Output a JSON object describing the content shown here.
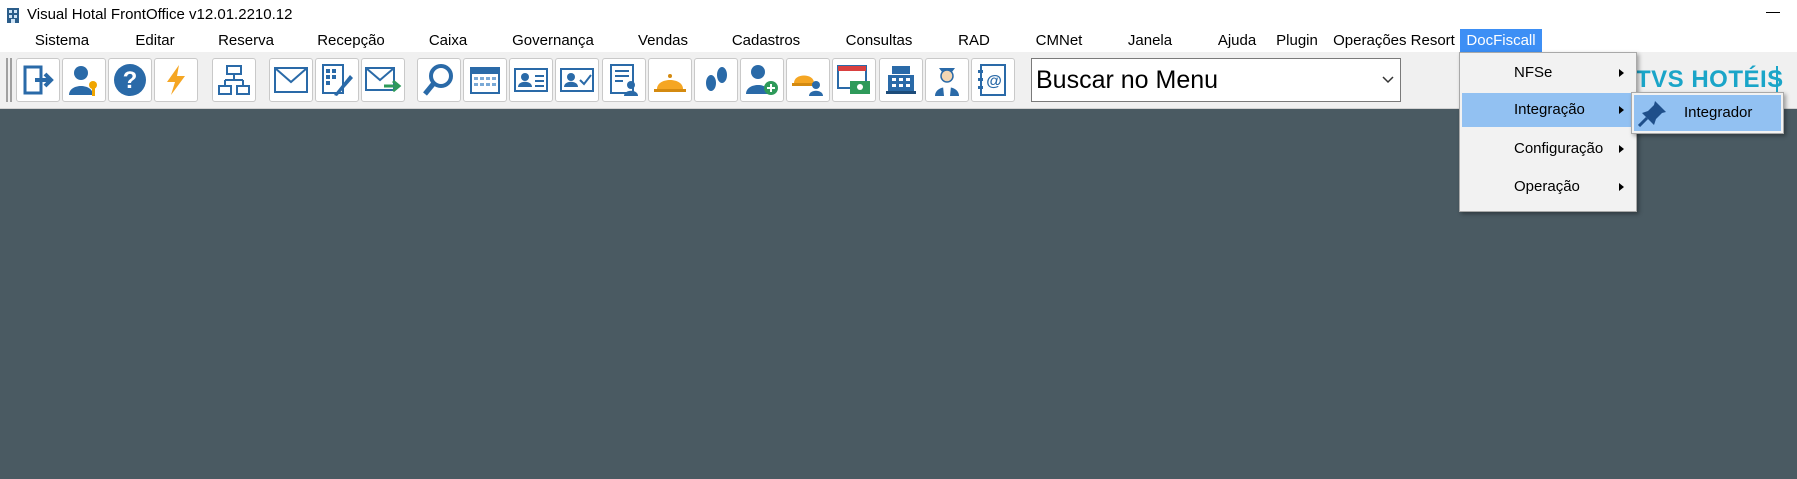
{
  "window": {
    "title": "Visual Hotal FrontOffice v12.01.2210.12"
  },
  "menu": [
    {
      "label": "Sistema"
    },
    {
      "label": "Editar"
    },
    {
      "label": "Reserva"
    },
    {
      "label": "Recepção"
    },
    {
      "label": "Caixa"
    },
    {
      "label": "Governança"
    },
    {
      "label": "Vendas"
    },
    {
      "label": "Cadastros"
    },
    {
      "label": "Consultas"
    },
    {
      "label": "RAD"
    },
    {
      "label": "CMNet"
    },
    {
      "label": "Janela"
    },
    {
      "label": "Ajuda"
    },
    {
      "label": "Plugin"
    },
    {
      "label": "Operações Resort"
    },
    {
      "label": "DocFiscall"
    }
  ],
  "toolbar": {
    "search_value": "Buscar no Menu",
    "icons": [
      "exit-icon",
      "user-key-icon",
      "help-icon",
      "lightning-icon",
      "org-chart-icon",
      "envelope-icon",
      "calculator-pen-icon",
      "envelope-send-icon",
      "magnifier-icon",
      "calendar-icon",
      "guest-card-icon",
      "guest-card-check-icon",
      "report-user-icon",
      "bell-icon",
      "footprints-icon",
      "add-user-icon",
      "bell-user-icon",
      "cash-window-icon",
      "cash-register-icon",
      "maid-icon",
      "address-book-icon"
    ]
  },
  "brand": {
    "text": "TVS HOTÉIS"
  },
  "dropdown": {
    "items": [
      {
        "label": "NFSe"
      },
      {
        "label": "Integração"
      },
      {
        "label": "Configuração"
      },
      {
        "label": "Operação"
      }
    ]
  },
  "submenu": {
    "items": [
      {
        "label": "Integrador"
      }
    ]
  },
  "colors": {
    "accent": "#3d8ff5",
    "highlight": "#92c1f2",
    "workspace": "#4a5a62",
    "brand": "#1aa5c8"
  }
}
